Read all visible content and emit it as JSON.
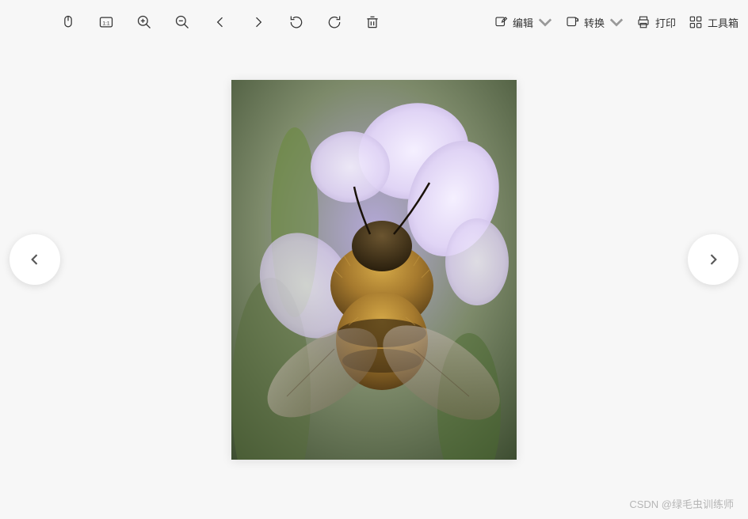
{
  "toolbar": {
    "edit_label": "编辑",
    "convert_label": "转换",
    "print_label": "打印",
    "toolbox_label": "工具箱",
    "actual_size_label": "1:1"
  },
  "watermark": {
    "text": "CSDN @绿毛虫训练师"
  },
  "image": {
    "description": "Macro photograph of a fuzzy brown bumblebee on pale lavender-white flowers, green blurred background"
  }
}
